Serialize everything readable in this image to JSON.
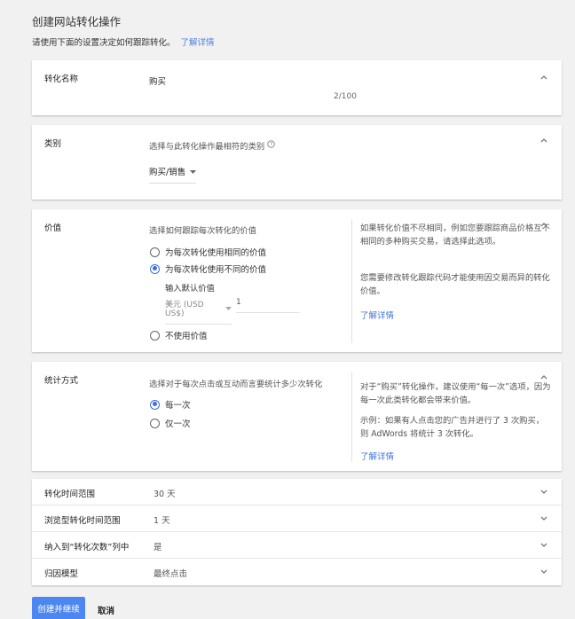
{
  "page": {
    "title": "创建网站转化操作",
    "subtitle": "请使用下面的设置决定如何跟踪转化。",
    "learn_more": "了解详情"
  },
  "name_card": {
    "label": "转化名称",
    "value": "购买",
    "counter": "2/100"
  },
  "category_card": {
    "label": "类别",
    "prompt": "选择与此转化操作最相符的类别",
    "help_icon": "help-circle-icon",
    "selected": "购买/销售"
  },
  "value_card": {
    "label": "价值",
    "prompt": "选择如何跟踪每次转化的价值",
    "options": {
      "same": "为每次转化使用相同的价值",
      "different": "为每次转化使用不同的价值",
      "none": "不使用价值"
    },
    "default_label": "输入默认价值",
    "currency": "美元 (USD US$)",
    "default_value": "1",
    "side_text_1": "如果转化价值不尽相同，例如您要跟踪商品价格互不相同的多种购买交易，请选择此选项。",
    "side_text_2": "您需要修改转化跟踪代码才能使用因交易而异的转化价值。",
    "learn_more": "了解详情"
  },
  "count_card": {
    "label": "统计方式",
    "prompt": "选择对于每次点击或互动而言要统计多少次转化",
    "options": {
      "every": "每一次",
      "one": "仅一次"
    },
    "side_text_1": "对于“购买”转化操作，建议使用“每一次”选项，因为每一次此类转化都会带来价值。",
    "side_text_2": "示例：如果有人点击您的广告并进行了 3 次购买，则 AdWords 将统计 3 次转化。",
    "learn_more": "了解详情"
  },
  "collapsed": [
    {
      "label": "转化时间范围",
      "value": "30 天"
    },
    {
      "label": "浏览型转化时间范围",
      "value": "1 天"
    },
    {
      "label": "纳入到“转化次数”列中",
      "value": "是"
    },
    {
      "label": "归因模型",
      "value": "最终点击"
    }
  ],
  "actions": {
    "create": "创建并继续",
    "cancel": "取消"
  },
  "colors": {
    "accent": "#4c86f0",
    "link": "#3f74d8",
    "background": "#f1f1f1"
  }
}
